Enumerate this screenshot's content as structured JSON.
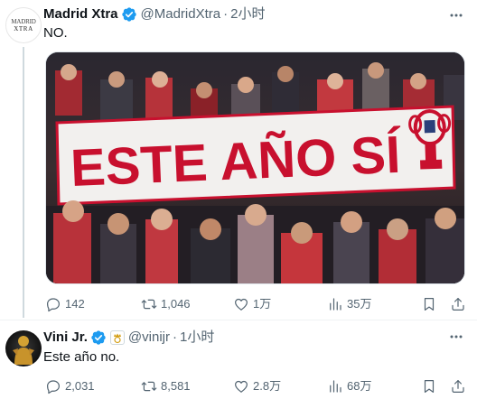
{
  "tweets": [
    {
      "author": {
        "name": "Madrid Xtra",
        "handle": "@MadridXtra",
        "avatar_text_line1": "MADRID",
        "avatar_text_line2": "XTRA"
      },
      "separator": "·",
      "time": "2小时",
      "text": "NO.",
      "media": {
        "banner_text": "ESTE AÑO SÍ"
      },
      "actions": {
        "replies": "142",
        "retweets": "1,046",
        "likes": "1万",
        "views": "35万"
      }
    },
    {
      "author": {
        "name": "Vini Jr.",
        "handle": "@vinijr"
      },
      "separator": "·",
      "time": "1小时",
      "text": "Este año no.",
      "actions": {
        "replies": "2,031",
        "retweets": "8,581",
        "likes": "2.8万",
        "views": "68万"
      }
    }
  ],
  "icons": {
    "verified": "verified-badge-icon",
    "more": "more-icon",
    "reply": "reply-icon",
    "retweet": "retweet-icon",
    "like": "heart-icon",
    "views": "views-chart-icon",
    "bookmark": "bookmark-icon",
    "share": "share-icon"
  },
  "colors": {
    "verified_blue": "#1d9bf0",
    "secondary_text": "#536471",
    "banner_red": "#c8102e"
  }
}
